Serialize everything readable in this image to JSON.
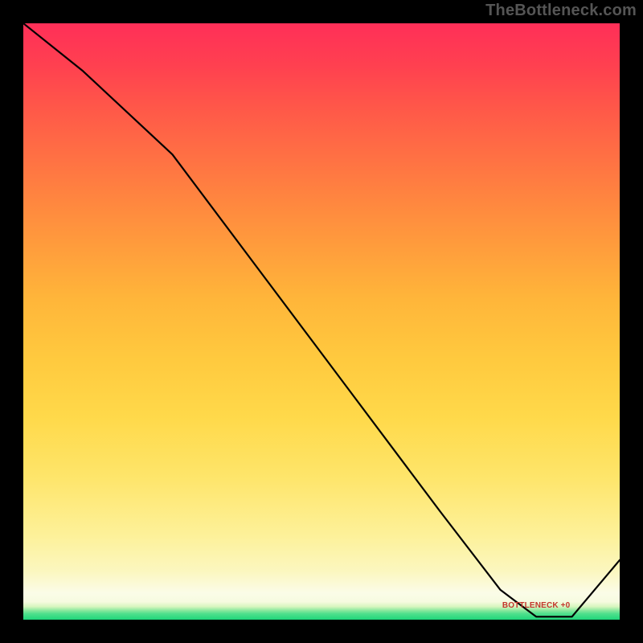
{
  "watermark": "TheBottleneck.com",
  "chart_data": {
    "type": "line",
    "title": "",
    "xlabel": "",
    "ylabel": "",
    "xlim": [
      0,
      100
    ],
    "ylim": [
      0,
      100
    ],
    "grid": false,
    "legend": false,
    "series": [
      {
        "name": "curve",
        "x": [
          0,
          10,
          25,
          40,
          55,
          70,
          80,
          86,
          89,
          92,
          100
        ],
        "y": [
          100,
          92,
          78,
          58,
          38,
          18,
          5,
          0.5,
          0.5,
          0.5,
          10
        ]
      }
    ],
    "annotations": [
      {
        "name": "bottom-label",
        "text": "BOTTLENECK +0",
        "x": 86,
        "y": 2
      }
    ],
    "background_gradient": {
      "type": "vertical",
      "stops": [
        {
          "pos": 0.0,
          "color": "#1fd67a"
        },
        {
          "pos": 0.03,
          "color": "#f6fbe0"
        },
        {
          "pos": 0.2,
          "color": "#fee56a"
        },
        {
          "pos": 0.5,
          "color": "#ffb53a"
        },
        {
          "pos": 0.8,
          "color": "#ff5f46"
        },
        {
          "pos": 1.0,
          "color": "#ff2f58"
        }
      ]
    }
  }
}
